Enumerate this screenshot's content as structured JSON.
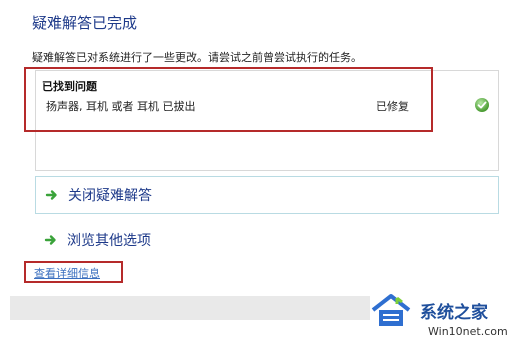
{
  "header": {
    "title": "疑难解答已完成",
    "description": "疑难解答已对系统进行了一些更改。请尝试之前曾尝试执行的任务。"
  },
  "results": {
    "section_title": "已找到问题",
    "problem": "扬声器, 耳机 或者 耳机 已拔出",
    "status": "已修复",
    "status_icon": "check-icon"
  },
  "actions": [
    {
      "label": "关闭疑难解答",
      "icon": "green-arrow-icon"
    },
    {
      "label": "浏览其他选项",
      "icon": "green-arrow-icon"
    }
  ],
  "details_link": "查看详细信息",
  "watermark": {
    "brand": "系统之家",
    "url": "Win10net.com"
  },
  "colors": {
    "title": "#1e3a8a",
    "highlight": "#b52a2a",
    "arrow": "#3aa33a",
    "button_border": "#b9dbe3"
  }
}
